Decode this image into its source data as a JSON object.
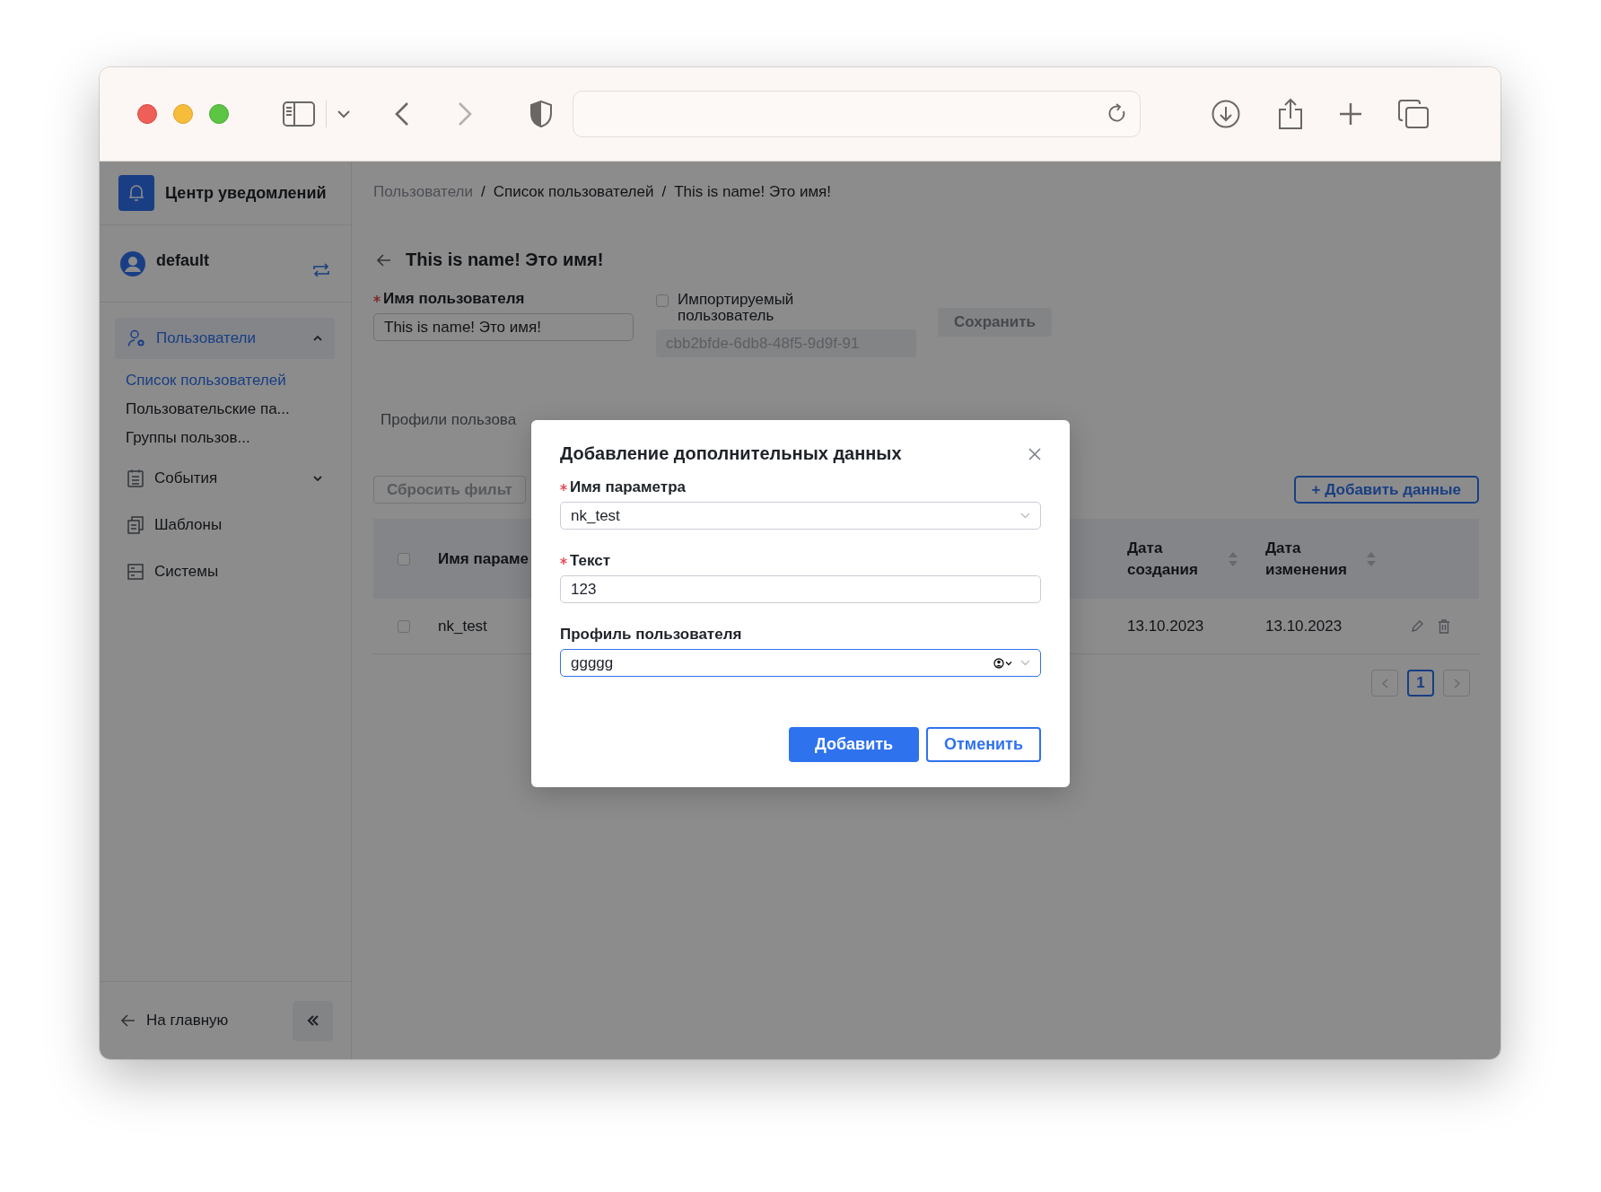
{
  "sidebar": {
    "app_title": "Центр уведомлений",
    "user": "default",
    "menu": [
      {
        "kind": "users",
        "label": "Пользователи",
        "selected": true,
        "expanded": true,
        "children": [
          {
            "label": "Список пользователей",
            "selected": true
          },
          {
            "label": "Пользовательские па...",
            "selected": false
          },
          {
            "label": "Группы пользов...",
            "selected": false
          }
        ]
      },
      {
        "kind": "events",
        "label": "События",
        "selected": false,
        "expanded": false
      },
      {
        "kind": "templates",
        "label": "Шаблоны",
        "selected": false
      },
      {
        "kind": "systems",
        "label": "Системы",
        "selected": false
      }
    ],
    "home_link": "На главную"
  },
  "breadcrumb": [
    {
      "label": "Пользователи",
      "muted": true
    },
    {
      "label": "Список пользователей",
      "muted": false
    },
    {
      "label": "This is name! Это имя!",
      "muted": false
    }
  ],
  "breadcrumb_separator": "/",
  "page_title": "This is name! Это имя!",
  "user_form": {
    "name_label": "Имя пользователя",
    "name_required": true,
    "name_value": "This is name! Это имя!",
    "imported_label": "Импортируемый пользователь",
    "imported_checked": false,
    "id_value": "cbb2bfde-6db8-48f5-9d9f-91",
    "save_button": "Сохранить",
    "save_disabled": true
  },
  "tabs": [
    {
      "label": "Профили пользова",
      "selected": false
    }
  ],
  "toolbar": {
    "reset_button": "Сбросить фильт",
    "add_button": "+ Добавить данные"
  },
  "table": {
    "header_checked": false,
    "columns": [
      {
        "label": "Имя параме",
        "sortable": false
      },
      {
        "label": "Дата создания",
        "sortable": true
      },
      {
        "label": "Дата изменения",
        "sortable": true
      }
    ],
    "rows": [
      {
        "checked": false,
        "cells": [
          "nk_test",
          "13.10.2023",
          "13.10.2023"
        ]
      }
    ]
  },
  "pagination": [
    {
      "label": "1",
      "selected": true
    }
  ],
  "modal": {
    "title": "Добавление дополнительных данных",
    "fields": [
      {
        "kind": "select",
        "label": "Имя параметра",
        "required": true,
        "value": "nk_test",
        "focused": false
      },
      {
        "kind": "text",
        "label": "Текст",
        "required": true,
        "value": "123",
        "focused": false
      },
      {
        "kind": "profile",
        "label": "Профиль пользователя",
        "required": false,
        "value": "ggggg",
        "focused": true
      }
    ],
    "buttons": [
      {
        "label": "Добавить",
        "kind": "primary"
      },
      {
        "label": "Отменить",
        "kind": "secondary"
      }
    ]
  }
}
